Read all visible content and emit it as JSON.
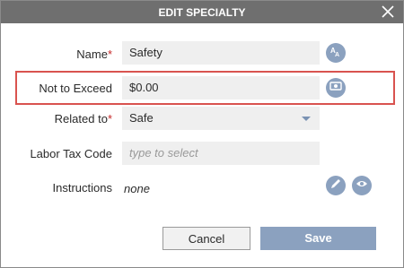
{
  "dialog": {
    "title": "EDIT SPECIALTY",
    "close_icon": "close-icon"
  },
  "fields": {
    "name": {
      "label": "Name",
      "required_mark": "*",
      "value": "Safety",
      "action_icon": "translate-icon"
    },
    "not_to_exceed": {
      "label": "Not to Exceed",
      "value": "$0.00",
      "action_icon": "currency-icon"
    },
    "related_to": {
      "label": "Related to",
      "required_mark": "*",
      "value": "Safe"
    },
    "labor_tax_code": {
      "label": "Labor Tax Code",
      "placeholder": "type to select"
    },
    "instructions": {
      "label": "Instructions",
      "value": "none",
      "edit_icon": "pencil-icon",
      "view_icon": "eye-icon"
    }
  },
  "buttons": {
    "cancel": "Cancel",
    "save": "Save"
  },
  "colors": {
    "titlebar": "#6f6f6f",
    "accent": "#8ba1bf",
    "highlight": "#d9534f",
    "field_bg": "#efefef"
  }
}
